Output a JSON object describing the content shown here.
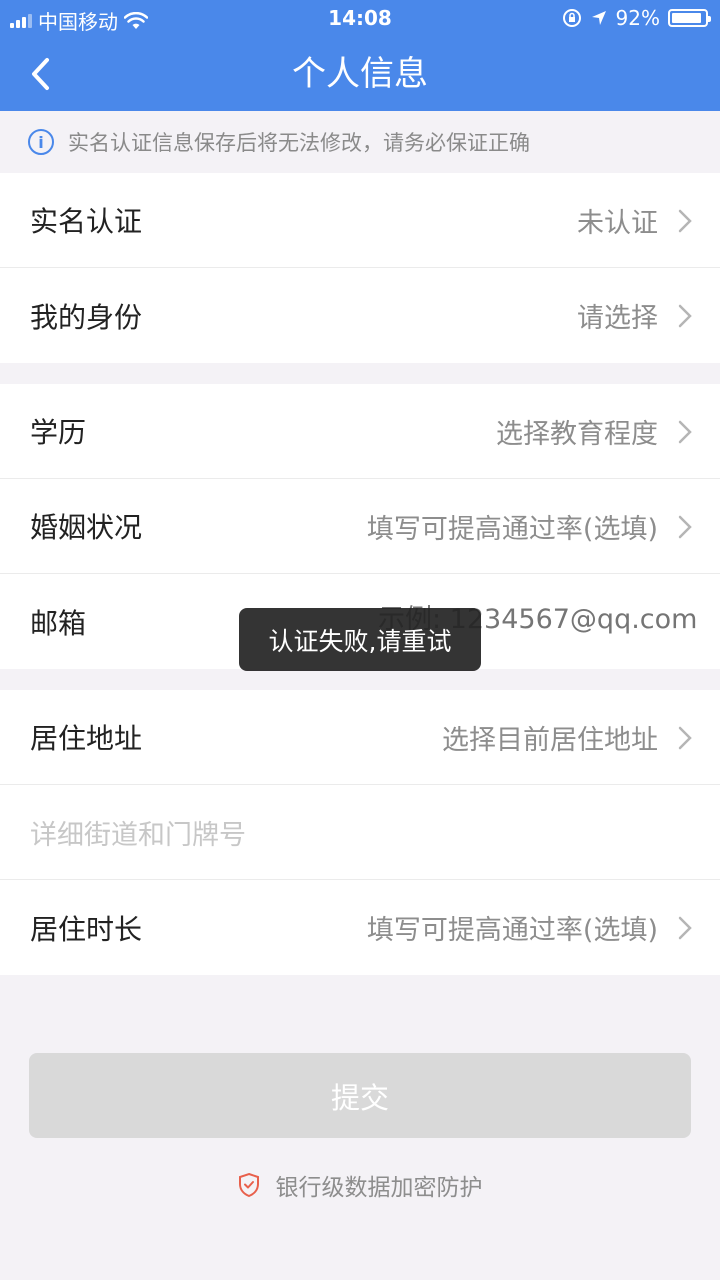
{
  "status_bar": {
    "carrier": "中国移动",
    "time": "14:08",
    "battery": "92%",
    "battery_level": 0.92
  },
  "header": {
    "title": "个人信息"
  },
  "notice": {
    "text": "实名认证信息保存后将无法修改，请务必保证正确"
  },
  "groups": {
    "identity": {
      "real_name": {
        "label": "实名认证",
        "value": "未认证"
      },
      "my_identity": {
        "label": "我的身份",
        "value": "请选择"
      }
    },
    "profile": {
      "education": {
        "label": "学历",
        "value": "选择教育程度"
      },
      "marriage": {
        "label": "婚姻状况",
        "value": "填写可提高通过率(选填)"
      },
      "email": {
        "label": "邮箱",
        "placeholder": "示例: 1234567@qq.com"
      }
    },
    "residence": {
      "address": {
        "label": "居住地址",
        "value": "选择目前居住地址"
      },
      "street": {
        "placeholder": "详细街道和门牌号"
      },
      "duration": {
        "label": "居住时长",
        "value": "填写可提高通过率(选填)"
      }
    }
  },
  "toast": {
    "text": "认证失败,请重试"
  },
  "submit": {
    "label": "提交"
  },
  "security": {
    "text": "银行级数据加密防护"
  },
  "colors": {
    "primary": "#4a88ea",
    "background": "#f4f2f6",
    "disabled_button": "#d9d9d9",
    "shield": "#e8604c"
  }
}
